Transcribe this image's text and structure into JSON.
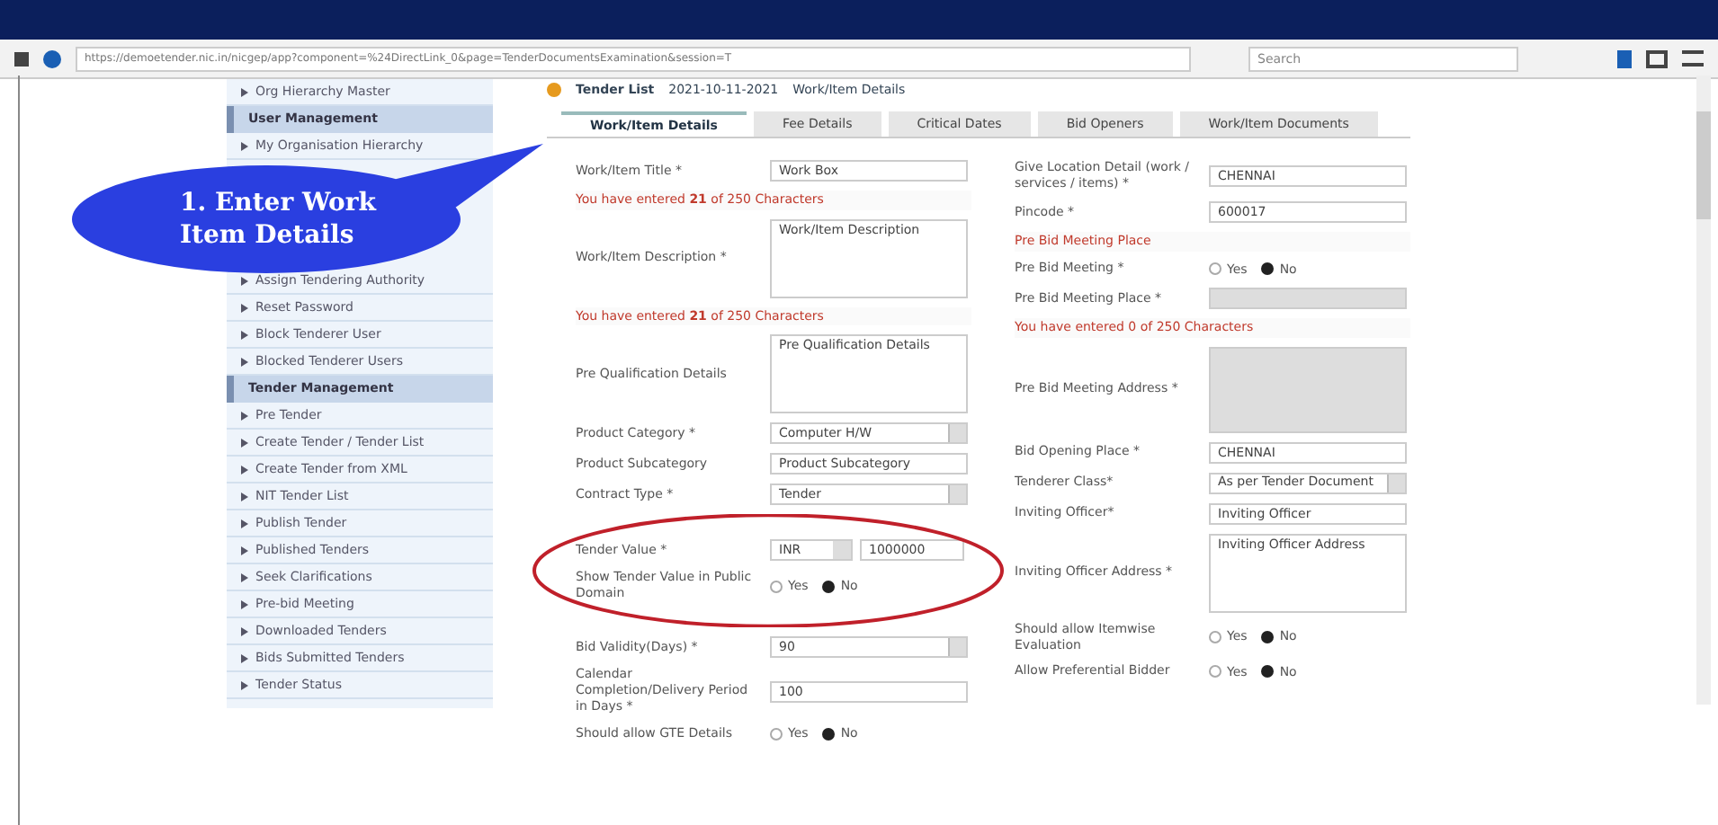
{
  "browser": {
    "url": "https://demoetender.nic.in/nicgep/app?component=%24DirectLink_0&page=TenderDocumentsExamination&session=T",
    "search_placeholder": "Search"
  },
  "sidebar": [
    {
      "kind": "item",
      "label": "Org Hierarchy Master"
    },
    {
      "kind": "header",
      "label": "User Management"
    },
    {
      "kind": "item",
      "label": "My Organisation Hierarchy"
    },
    {
      "kind": "covered"
    },
    {
      "kind": "covered"
    },
    {
      "kind": "covered"
    },
    {
      "kind": "covered"
    },
    {
      "kind": "item",
      "label": "Assign Tendering Authority"
    },
    {
      "kind": "item",
      "label": "Reset Password"
    },
    {
      "kind": "item",
      "label": "Block Tenderer User"
    },
    {
      "kind": "item",
      "label": "Blocked Tenderer Users"
    },
    {
      "kind": "header",
      "label": "Tender Management"
    },
    {
      "kind": "item",
      "label": "Pre Tender"
    },
    {
      "kind": "item",
      "label": "Create Tender / Tender List"
    },
    {
      "kind": "item",
      "label": "Create Tender from XML"
    },
    {
      "kind": "item",
      "label": "NIT Tender List"
    },
    {
      "kind": "item",
      "label": "Publish Tender"
    },
    {
      "kind": "item",
      "label": "Published Tenders"
    },
    {
      "kind": "item",
      "label": "Seek Clarifications"
    },
    {
      "kind": "item",
      "label": "Pre-bid Meeting"
    },
    {
      "kind": "item",
      "label": "Downloaded Tenders"
    },
    {
      "kind": "item",
      "label": "Bids Submitted Tenders"
    },
    {
      "kind": "item",
      "label": "Tender Status"
    }
  ],
  "breadcrumb": [
    "Tender List",
    "2021-10-11-2021",
    "Work/Item Details"
  ],
  "tabs": [
    {
      "label": "Work/Item Details",
      "selected": true
    },
    {
      "label": "Fee Details",
      "selected": false
    },
    {
      "label": "Critical Dates",
      "selected": false
    },
    {
      "label": "Bid Openers",
      "selected": false
    },
    {
      "label": "Work/Item Documents",
      "selected": false
    }
  ],
  "left_fields": [
    {
      "kind": "text",
      "label": "Work/Item Title *",
      "value": "Work Box"
    },
    {
      "kind": "note",
      "text": "You have entered **21** of 250 Characters"
    },
    {
      "kind": "textarea",
      "label": "Work/Item Description *",
      "value": "Work/Item Description"
    },
    {
      "kind": "note",
      "text": "You have entered **21** of 250 Characters"
    },
    {
      "kind": "textarea",
      "label": "Pre Qualification Details",
      "value": "Pre Qualification Details"
    },
    {
      "kind": "select",
      "label": "Product Category *",
      "value": "Computer H/W"
    },
    {
      "kind": "text",
      "label": "Product Subcategory",
      "value": "Product Subcategory"
    },
    {
      "kind": "select",
      "label": "Contract Type *",
      "value": "Tender"
    },
    {
      "kind": "money",
      "highlighted": true,
      "label": "Tender Value *",
      "currency": "INR",
      "value": "1000000"
    },
    {
      "kind": "radio",
      "highlighted": true,
      "label": "Show Tender Value in Public Domain",
      "options": [
        {
          "label": "Yes",
          "selected": false
        },
        {
          "label": "No",
          "selected": true
        }
      ]
    },
    {
      "kind": "select",
      "label": "Bid Validity(Days) *",
      "value": "90"
    },
    {
      "kind": "text",
      "label": "Calendar Completion/Delivery Period in Days *",
      "value": "100"
    },
    {
      "kind": "radio",
      "label": "Should allow GTE Details",
      "options": [
        {
          "label": "Yes",
          "selected": false
        },
        {
          "label": "No",
          "selected": true
        }
      ]
    }
  ],
  "right_fields": [
    {
      "kind": "text",
      "label": "Give Location Detail (work / services / items) *",
      "value": "CHENNAI"
    },
    {
      "kind": "text",
      "label": "Pincode *",
      "value": "600017"
    },
    {
      "kind": "note",
      "text": "Pre Bid Meeting Place"
    },
    {
      "kind": "radio",
      "label": "Pre Bid Meeting *",
      "options": [
        {
          "label": "Yes",
          "selected": false
        },
        {
          "label": "No",
          "selected": true
        }
      ]
    },
    {
      "kind": "disabled",
      "label": "Pre Bid Meeting Place *"
    },
    {
      "kind": "note",
      "text": "You have entered  0 of 250 Characters"
    },
    {
      "kind": "disabled_area",
      "label": "Pre Bid Meeting Address *"
    },
    {
      "kind": "text",
      "label": "Bid Opening Place *",
      "value": "CHENNAI"
    },
    {
      "kind": "select",
      "label": "Tenderer Class*",
      "value": "As per Tender Document"
    },
    {
      "kind": "text",
      "label": "Inviting Officer*",
      "value": "Inviting Officer"
    },
    {
      "kind": "textarea",
      "label": "Inviting Officer Address *",
      "value": "Inviting Officer Address"
    },
    {
      "kind": "radio",
      "label": "Should allow Itemwise Evaluation",
      "options": [
        {
          "label": "Yes",
          "selected": false
        },
        {
          "label": "No",
          "selected": true
        }
      ]
    },
    {
      "kind": "radio",
      "label": "Allow Preferential Bidder",
      "options": [
        {
          "label": "Yes",
          "selected": false
        },
        {
          "label": "No",
          "selected": true
        }
      ]
    }
  ],
  "callout": {
    "text": "1. Enter Work Item Details"
  }
}
